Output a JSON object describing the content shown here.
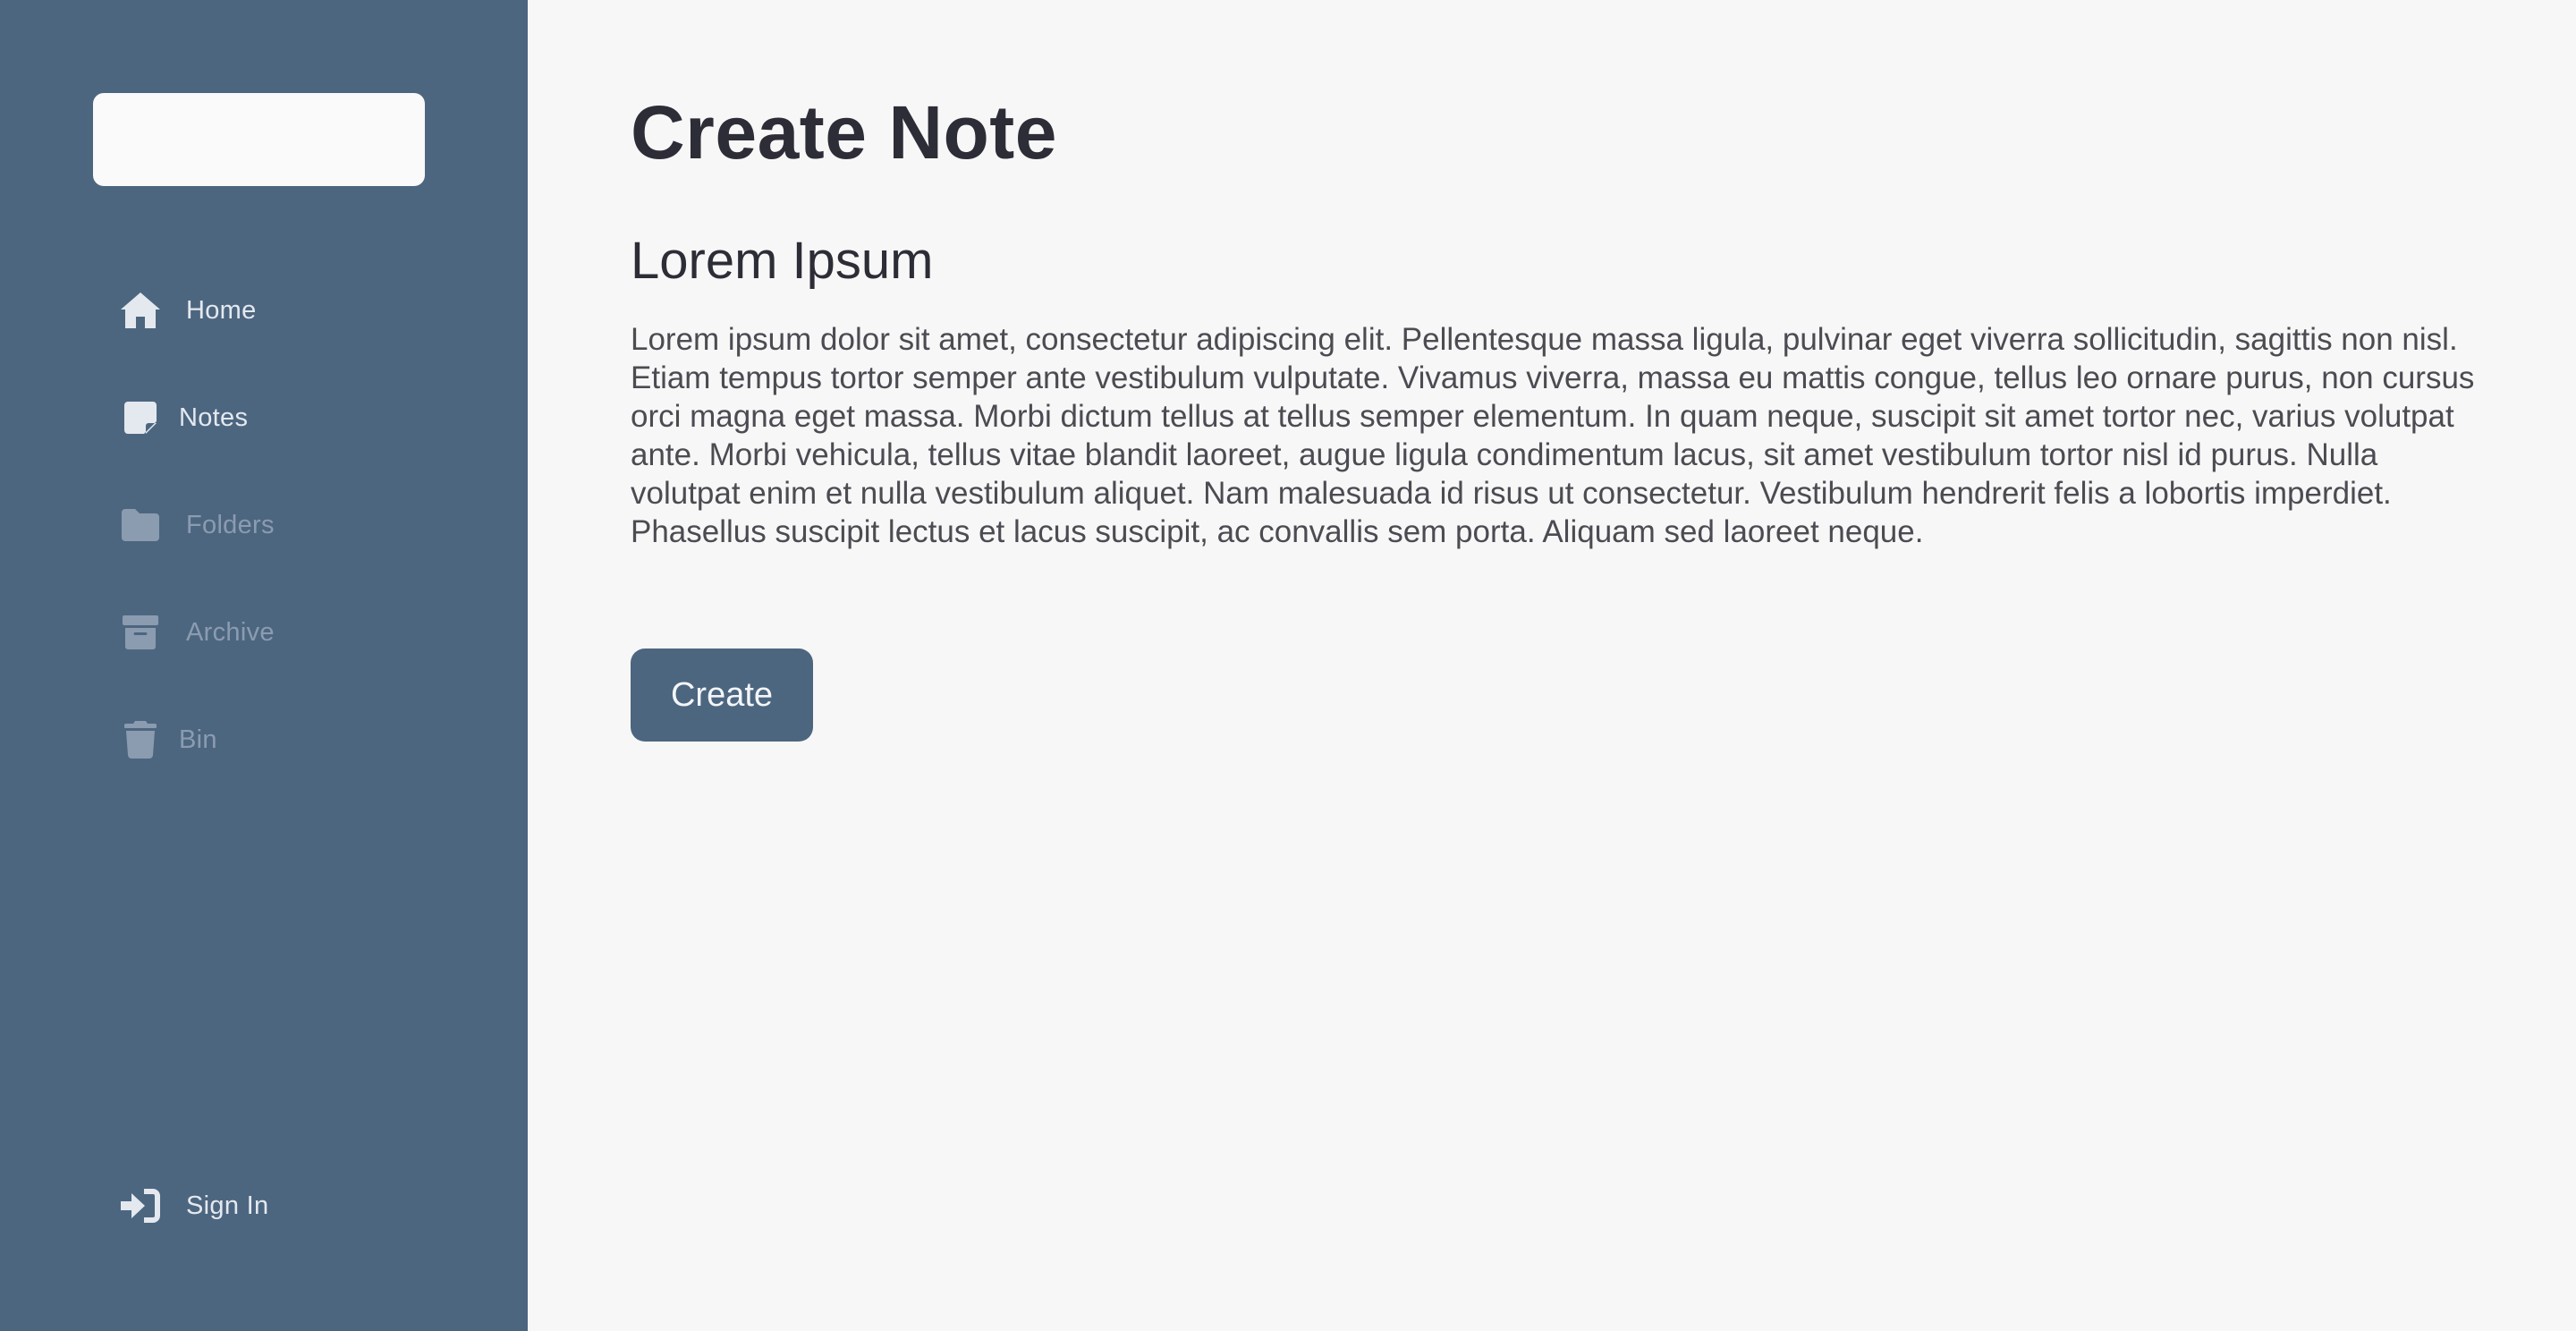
{
  "sidebar": {
    "items": [
      {
        "label": "Home",
        "icon": "home-icon",
        "state": "active"
      },
      {
        "label": "Notes",
        "icon": "note-icon",
        "state": "active"
      },
      {
        "label": "Folders",
        "icon": "folder-icon",
        "state": "inactive"
      },
      {
        "label": "Archive",
        "icon": "archive-icon",
        "state": "inactive"
      },
      {
        "label": "Bin",
        "icon": "trash-icon",
        "state": "inactive"
      }
    ],
    "footer": {
      "label": "Sign In",
      "icon": "sign-in-icon"
    }
  },
  "main": {
    "title": "Create Note",
    "note": {
      "title": "Lorem Ipsum",
      "body": "Lorem ipsum dolor sit amet, consectetur adipiscing elit. Pellentesque massa ligula, pulvinar eget viverra sollicitudin, sagittis non nisl. Etiam tempus tortor semper ante vestibulum vulputate. Vivamus viverra, massa eu mattis congue, tellus leo ornare purus, non cursus orci magna eget massa. Morbi dictum tellus at tellus semper elementum. In quam neque, suscipit sit amet tortor nec, varius volutpat ante. Morbi vehicula, tellus vitae blandit laoreet, augue ligula condimentum lacus, sit amet vestibulum tortor nisl id purus. Nulla volutpat enim et nulla vestibulum aliquet. Nam malesuada id risus ut consectetur. Vestibulum hendrerit felis a lobortis imperdiet. Phasellus suscipit lectus et lacus suscipit, ac convallis sem porta. Aliquam sed laoreet neque."
    },
    "create_label": "Create"
  },
  "colors": {
    "sidebar_bg": "#4d6680",
    "page_bg": "#f7f7f7",
    "button_bg": "#4d6680",
    "heading_text": "#2d2d37",
    "active_nav": "#e4e9ef",
    "inactive_nav": "#8b9cb0"
  }
}
